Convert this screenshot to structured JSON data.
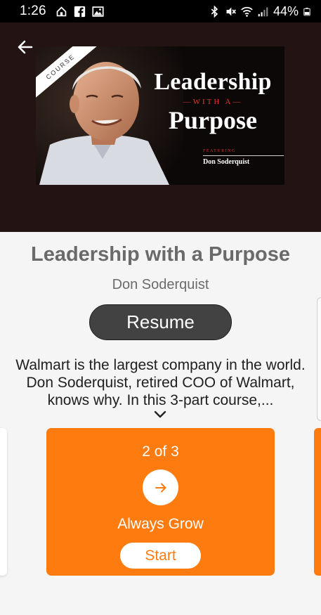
{
  "status_bar": {
    "time": "1:26",
    "battery_percent": "44%",
    "left_icons": [
      "home-icon",
      "facebook-icon",
      "image-icon"
    ],
    "right_icons": [
      "bluetooth-icon",
      "mute-icon",
      "wifi-icon",
      "signal-icon",
      "battery-icon"
    ]
  },
  "hero": {
    "thumbnail": {
      "ribbon": "COURSE",
      "title_line1": "Leadership",
      "title_with": "—WITH A—",
      "title_line2": "Purpose",
      "featuring": "FEATURING",
      "featured_name": "Don Soderquist"
    }
  },
  "course": {
    "title": "Leadership with a Purpose",
    "author": "Don Soderquist",
    "resume_label": "Resume",
    "description": "Walmart is the largest company in the world. Don Soderquist, retired COO of Walmart, knows why. In this 3-part course,..."
  },
  "lesson": {
    "count": "2 of 3",
    "title": "Always Grow",
    "start_label": "Start"
  },
  "colors": {
    "accent": "#fd7b0f",
    "hero_bg": "#231313",
    "resume_bg": "#424242",
    "status_bg": "#000000"
  }
}
